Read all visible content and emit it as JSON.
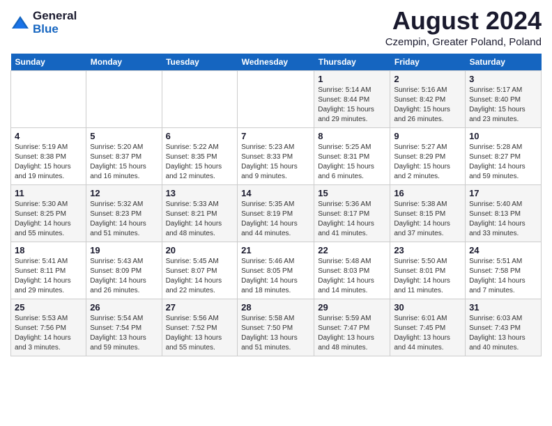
{
  "logo": {
    "general": "General",
    "blue": "Blue"
  },
  "title": {
    "month_year": "August 2024",
    "location": "Czempin, Greater Poland, Poland"
  },
  "headers": [
    "Sunday",
    "Monday",
    "Tuesday",
    "Wednesday",
    "Thursday",
    "Friday",
    "Saturday"
  ],
  "weeks": [
    [
      {
        "day": "",
        "info": ""
      },
      {
        "day": "",
        "info": ""
      },
      {
        "day": "",
        "info": ""
      },
      {
        "day": "",
        "info": ""
      },
      {
        "day": "1",
        "info": "Sunrise: 5:14 AM\nSunset: 8:44 PM\nDaylight: 15 hours\nand 29 minutes."
      },
      {
        "day": "2",
        "info": "Sunrise: 5:16 AM\nSunset: 8:42 PM\nDaylight: 15 hours\nand 26 minutes."
      },
      {
        "day": "3",
        "info": "Sunrise: 5:17 AM\nSunset: 8:40 PM\nDaylight: 15 hours\nand 23 minutes."
      }
    ],
    [
      {
        "day": "4",
        "info": "Sunrise: 5:19 AM\nSunset: 8:38 PM\nDaylight: 15 hours\nand 19 minutes."
      },
      {
        "day": "5",
        "info": "Sunrise: 5:20 AM\nSunset: 8:37 PM\nDaylight: 15 hours\nand 16 minutes."
      },
      {
        "day": "6",
        "info": "Sunrise: 5:22 AM\nSunset: 8:35 PM\nDaylight: 15 hours\nand 12 minutes."
      },
      {
        "day": "7",
        "info": "Sunrise: 5:23 AM\nSunset: 8:33 PM\nDaylight: 15 hours\nand 9 minutes."
      },
      {
        "day": "8",
        "info": "Sunrise: 5:25 AM\nSunset: 8:31 PM\nDaylight: 15 hours\nand 6 minutes."
      },
      {
        "day": "9",
        "info": "Sunrise: 5:27 AM\nSunset: 8:29 PM\nDaylight: 15 hours\nand 2 minutes."
      },
      {
        "day": "10",
        "info": "Sunrise: 5:28 AM\nSunset: 8:27 PM\nDaylight: 14 hours\nand 59 minutes."
      }
    ],
    [
      {
        "day": "11",
        "info": "Sunrise: 5:30 AM\nSunset: 8:25 PM\nDaylight: 14 hours\nand 55 minutes."
      },
      {
        "day": "12",
        "info": "Sunrise: 5:32 AM\nSunset: 8:23 PM\nDaylight: 14 hours\nand 51 minutes."
      },
      {
        "day": "13",
        "info": "Sunrise: 5:33 AM\nSunset: 8:21 PM\nDaylight: 14 hours\nand 48 minutes."
      },
      {
        "day": "14",
        "info": "Sunrise: 5:35 AM\nSunset: 8:19 PM\nDaylight: 14 hours\nand 44 minutes."
      },
      {
        "day": "15",
        "info": "Sunrise: 5:36 AM\nSunset: 8:17 PM\nDaylight: 14 hours\nand 41 minutes."
      },
      {
        "day": "16",
        "info": "Sunrise: 5:38 AM\nSunset: 8:15 PM\nDaylight: 14 hours\nand 37 minutes."
      },
      {
        "day": "17",
        "info": "Sunrise: 5:40 AM\nSunset: 8:13 PM\nDaylight: 14 hours\nand 33 minutes."
      }
    ],
    [
      {
        "day": "18",
        "info": "Sunrise: 5:41 AM\nSunset: 8:11 PM\nDaylight: 14 hours\nand 29 minutes."
      },
      {
        "day": "19",
        "info": "Sunrise: 5:43 AM\nSunset: 8:09 PM\nDaylight: 14 hours\nand 26 minutes."
      },
      {
        "day": "20",
        "info": "Sunrise: 5:45 AM\nSunset: 8:07 PM\nDaylight: 14 hours\nand 22 minutes."
      },
      {
        "day": "21",
        "info": "Sunrise: 5:46 AM\nSunset: 8:05 PM\nDaylight: 14 hours\nand 18 minutes."
      },
      {
        "day": "22",
        "info": "Sunrise: 5:48 AM\nSunset: 8:03 PM\nDaylight: 14 hours\nand 14 minutes."
      },
      {
        "day": "23",
        "info": "Sunrise: 5:50 AM\nSunset: 8:01 PM\nDaylight: 14 hours\nand 11 minutes."
      },
      {
        "day": "24",
        "info": "Sunrise: 5:51 AM\nSunset: 7:58 PM\nDaylight: 14 hours\nand 7 minutes."
      }
    ],
    [
      {
        "day": "25",
        "info": "Sunrise: 5:53 AM\nSunset: 7:56 PM\nDaylight: 14 hours\nand 3 minutes."
      },
      {
        "day": "26",
        "info": "Sunrise: 5:54 AM\nSunset: 7:54 PM\nDaylight: 13 hours\nand 59 minutes."
      },
      {
        "day": "27",
        "info": "Sunrise: 5:56 AM\nSunset: 7:52 PM\nDaylight: 13 hours\nand 55 minutes."
      },
      {
        "day": "28",
        "info": "Sunrise: 5:58 AM\nSunset: 7:50 PM\nDaylight: 13 hours\nand 51 minutes."
      },
      {
        "day": "29",
        "info": "Sunrise: 5:59 AM\nSunset: 7:47 PM\nDaylight: 13 hours\nand 48 minutes."
      },
      {
        "day": "30",
        "info": "Sunrise: 6:01 AM\nSunset: 7:45 PM\nDaylight: 13 hours\nand 44 minutes."
      },
      {
        "day": "31",
        "info": "Sunrise: 6:03 AM\nSunset: 7:43 PM\nDaylight: 13 hours\nand 40 minutes."
      }
    ]
  ]
}
